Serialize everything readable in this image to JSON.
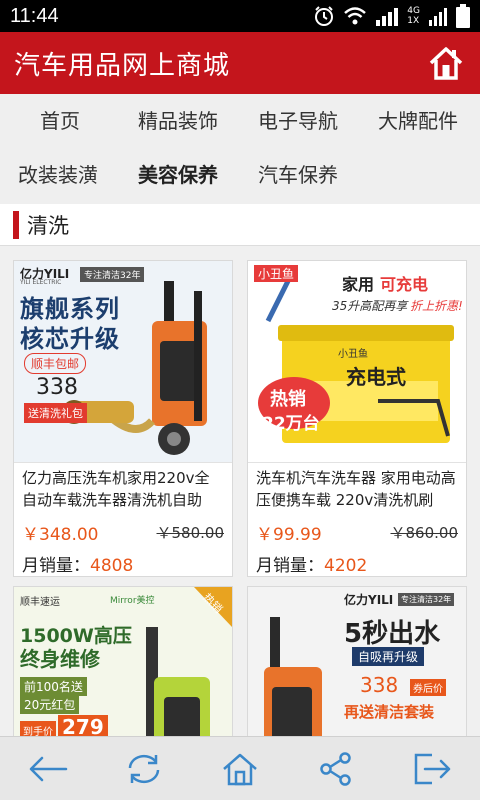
{
  "status_bar": {
    "time": "11:44",
    "network_label_top": "4G",
    "network_label_bottom": "1X"
  },
  "header": {
    "title": "汽车用品网上商城",
    "home_icon": "home-icon"
  },
  "nav": {
    "items": [
      {
        "label": "首页"
      },
      {
        "label": "精品装饰"
      },
      {
        "label": "电子导航"
      },
      {
        "label": "大牌配件"
      },
      {
        "label": "改装装潢"
      },
      {
        "label": "美容保养",
        "active": true
      },
      {
        "label": "汽车保养"
      }
    ]
  },
  "section": {
    "title": "清洗"
  },
  "products": [
    {
      "name": "亿力高压洗车机家用220v全自动车载洗车器清洗机自助",
      "price": "￥348.00",
      "old_price": "￥580.00",
      "sales_label": "月销量：",
      "sales": "4808",
      "image_text": {
        "brand": "亿力YILI",
        "brand_sub": "YILI ELECTRIC",
        "tag": "专注清洁32年",
        "line1": "旗舰系列",
        "line2": "核芯升级",
        "shipping": "顺丰包邮",
        "price": "338",
        "gift": "送清洗礼包"
      }
    },
    {
      "name": "洗车机汽车洗车器 家用电动高压便携车载 220v清洗机刷",
      "price": "￥99.99",
      "old_price": "￥860.00",
      "sales_label": "月销量：",
      "sales": "4202",
      "image_text": {
        "brand": "小丑鱼",
        "headline_a": "家用",
        "headline_b": "可充电",
        "promo_a": "35升高配再享",
        "promo_b": "折上折惠!",
        "box_brand": "小丑鱼",
        "box_brand2": "充电式",
        "hot_a": "热销",
        "hot_b": "22万台"
      }
    },
    {
      "name": "",
      "image_text": {
        "express": "顺丰速运",
        "brand": "Mirror美控",
        "corner": "热销",
        "line1": "1500W高压",
        "line2": "终身维修",
        "coupon1": "前100名送",
        "coupon2": "20元红包",
        "price_label": "到手价",
        "price": "279"
      }
    },
    {
      "name": "",
      "image_text": {
        "brand": "亿力YILI",
        "tag": "专注清洁32年",
        "line1": "5秒出水",
        "line2": "自吸再升级",
        "price": "338",
        "price_tag": "券后价",
        "gift": "再送清洁套装"
      }
    }
  ],
  "toolbar": {
    "buttons": [
      "back-icon",
      "refresh-icon",
      "home-icon",
      "share-icon",
      "exit-icon"
    ]
  },
  "colors": {
    "header_red": "#c4151c",
    "price_orange": "#e8571b",
    "nav_bg": "#efefef",
    "toolbar_bg": "#e7e7e7",
    "toolbar_icon": "#3a87c9"
  }
}
